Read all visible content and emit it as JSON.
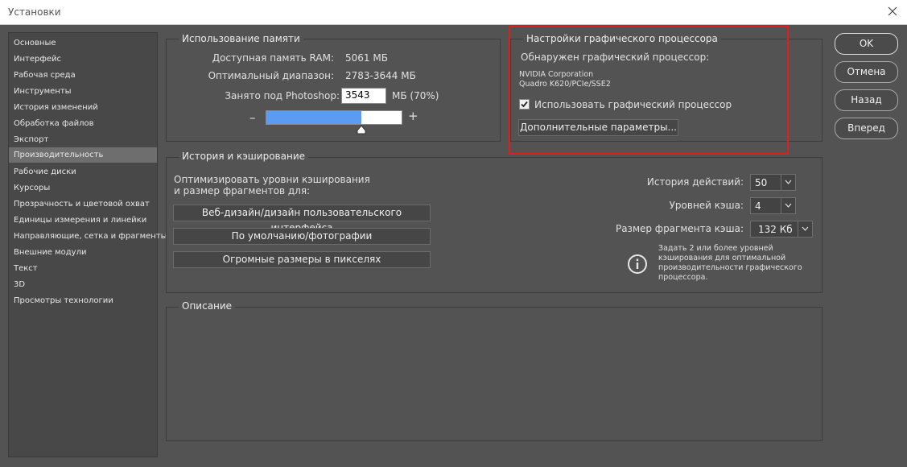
{
  "window": {
    "title": "Установки"
  },
  "sidebar": {
    "items": [
      {
        "label": "Основные"
      },
      {
        "label": "Интерфейс"
      },
      {
        "label": "Рабочая среда"
      },
      {
        "label": "Инструменты"
      },
      {
        "label": "История изменений"
      },
      {
        "label": "Обработка файлов"
      },
      {
        "label": "Экспорт"
      },
      {
        "label": "Производительность",
        "selected": true
      },
      {
        "label": "Рабочие диски"
      },
      {
        "label": "Курсоры"
      },
      {
        "label": "Прозрачность и цветовой охват"
      },
      {
        "label": "Единицы измерения и линейки"
      },
      {
        "label": "Направляющие, сетка и фрагменты"
      },
      {
        "label": "Внешние модули"
      },
      {
        "label": "Текст"
      },
      {
        "label": "3D"
      },
      {
        "label": "Просмотры технологии"
      }
    ]
  },
  "memory": {
    "title": "Использование памяти",
    "available_label": "Доступная память RAM:",
    "available_value": "5061 МБ",
    "ideal_label": "Оптимальный диапазон:",
    "ideal_value": "2783-3644 МБ",
    "used_label": "Занято под Photoshop:",
    "used_value": "3543",
    "used_unit": "МБ (70%)",
    "slider_fraction": 0.7,
    "minus": "–",
    "plus": "+"
  },
  "gpu": {
    "title": "Настройки графического процессора",
    "detected_label": "Обнаружен графический процессор:",
    "vendor": "NVIDIA Corporation",
    "model": "Quadro K620/PCIe/SSE2",
    "use_gpu_label": "Использовать графический процессор",
    "use_gpu_checked": true,
    "advanced_button": "Дополнительные параметры..."
  },
  "history": {
    "title": "История и кэширование",
    "optimize_line1": "Оптимизировать уровни кэширования",
    "optimize_line2": "и размер фрагментов для:",
    "presets": [
      "Веб-дизайн/дизайн пользовательского интерфейса",
      "По умолчанию/фотографии",
      "Огромные размеры в пикселях"
    ],
    "history_states_label": "История действий:",
    "history_states_value": "50",
    "cache_levels_label": "Уровней кэша:",
    "cache_levels_value": "4",
    "tile_size_label": "Размер фрагмента кэша:",
    "tile_size_value": "132 Кб",
    "info_text": "Задать 2 или более уровней кэширования для оптимальной производительности графического процессора."
  },
  "description": {
    "title": "Описание"
  },
  "buttons": {
    "ok": "OK",
    "cancel": "Отмена",
    "prev": "Назад",
    "next": "Вперед"
  },
  "colors": {
    "background": "#535353",
    "slider_fill": "#5b9cf0",
    "highlight": "#e11e1e"
  }
}
